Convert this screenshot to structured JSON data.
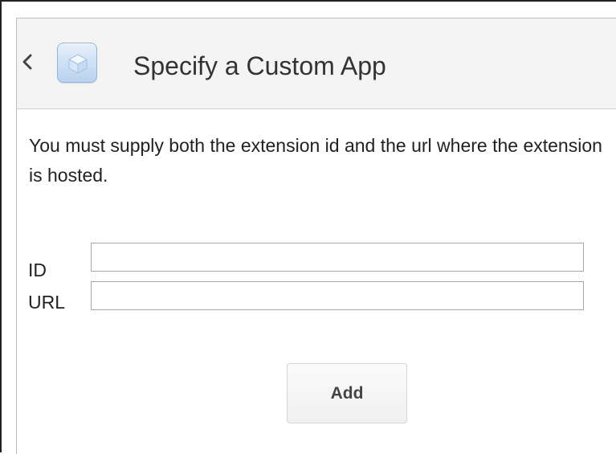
{
  "header": {
    "title": "Specify a Custom App",
    "back_icon": "chevron-left-icon",
    "app_icon": "app-cube-icon"
  },
  "description": "You must supply both the extension id and the url where the extension is hosted.",
  "form": {
    "id_label": "ID",
    "id_value": "",
    "url_label": "URL",
    "url_value": ""
  },
  "add_button_label": "Add",
  "colors": {
    "header_bg": "#f4f4f4",
    "icon_blue": "#b8d2ef",
    "text": "#222222"
  }
}
